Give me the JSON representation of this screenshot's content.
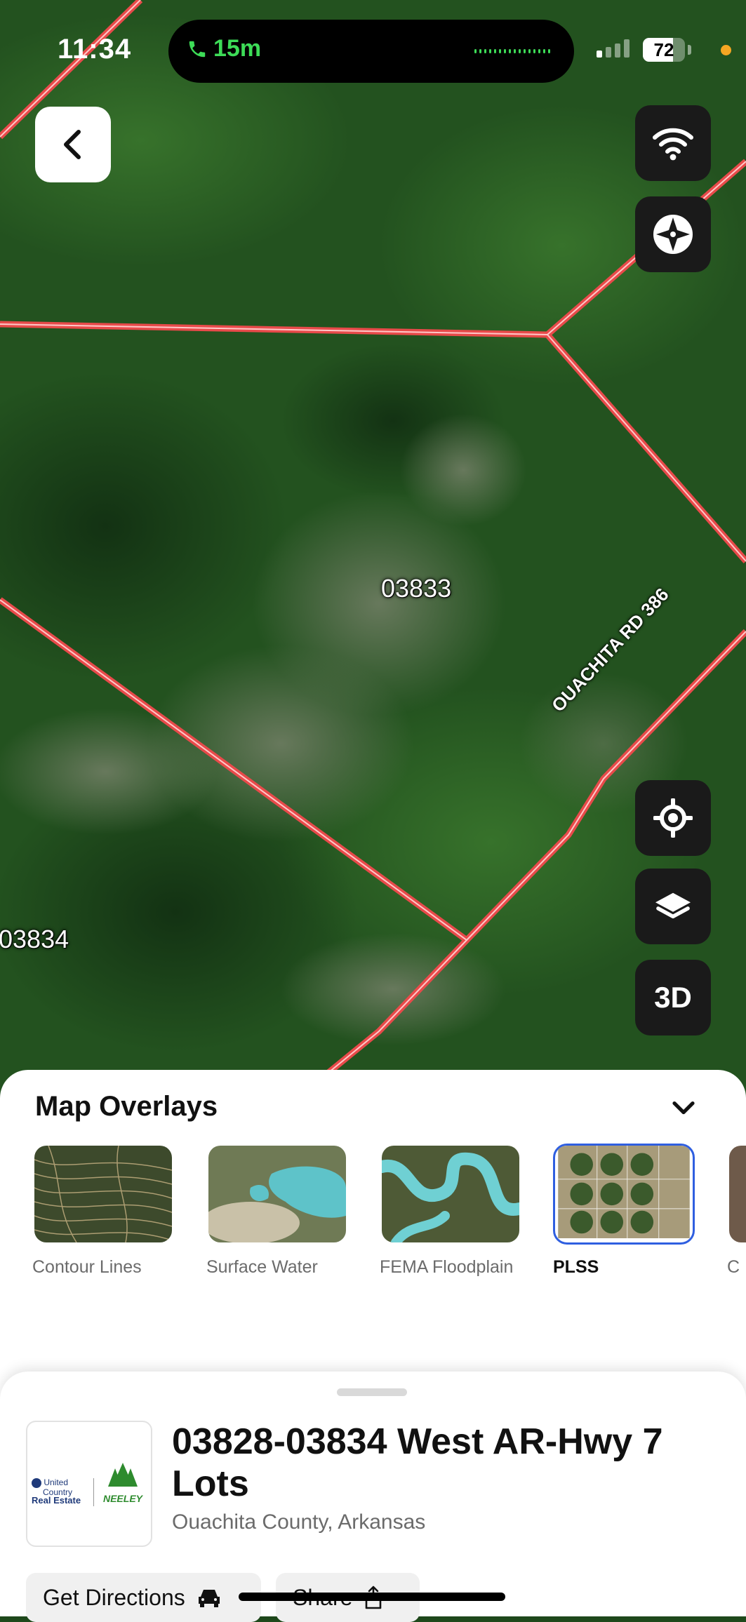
{
  "status_bar": {
    "time": "11:34",
    "call_duration": "15m",
    "battery": "72",
    "battery_level": 0.72
  },
  "map": {
    "parcel_labels": [
      "03833",
      "03834"
    ],
    "road_label": "OUACHITA RD 386",
    "controls": {
      "three_d_label": "3D"
    },
    "colors": {
      "parcel_line": "#e84a4a"
    },
    "icons": [
      "chevron-left-icon",
      "wifi-icon",
      "compass-icon",
      "locate-icon",
      "layers-icon"
    ]
  },
  "overlays": {
    "title": "Map Overlays",
    "items": [
      {
        "label": "Contour Lines",
        "selected": false
      },
      {
        "label": "Surface Water",
        "selected": false
      },
      {
        "label": "FEMA Floodplain",
        "selected": false
      },
      {
        "label": "PLSS",
        "selected": true
      },
      {
        "label": "C",
        "selected": false
      }
    ],
    "colors": {
      "selected_border": "#2f5fe0"
    }
  },
  "listing": {
    "title": "03828-03834 West AR-Hwy 7 Lots",
    "location": "Ouachita County, Arkansas",
    "logo": {
      "left_text_1": "United",
      "left_text_2": "Country",
      "left_text_3": "Real Estate",
      "right_text": "NEELEY"
    },
    "actions": {
      "directions": "Get Directions",
      "share": "Share"
    }
  }
}
